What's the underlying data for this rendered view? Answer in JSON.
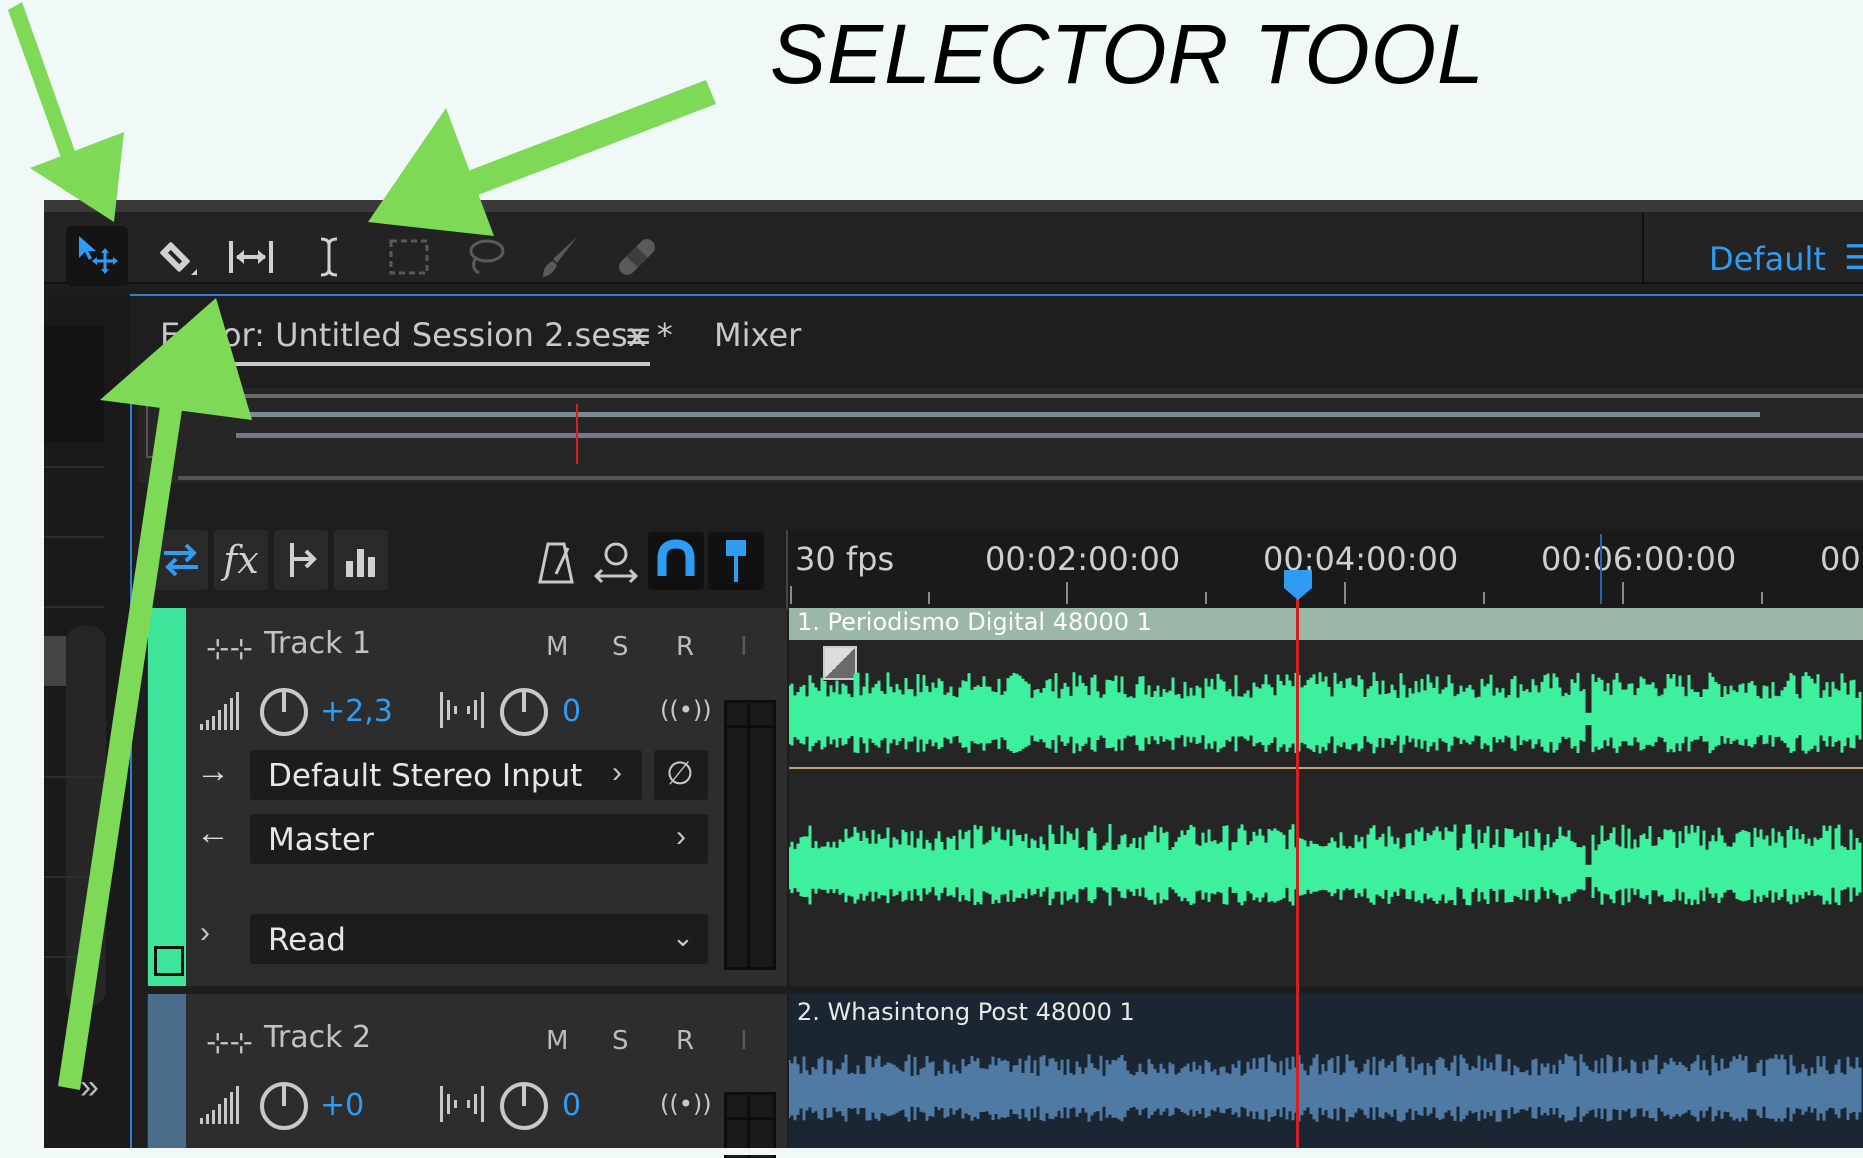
{
  "annotation": {
    "title": "SELECTOR TOOL"
  },
  "toolbar": {
    "tools": [
      {
        "name": "move-tool",
        "icon": "move-selection-icon"
      },
      {
        "name": "razor-tool",
        "icon": "razor-blade-icon"
      },
      {
        "name": "slip-tool",
        "icon": "slip-arrows-icon"
      },
      {
        "name": "time-selection-tool",
        "icon": "i-beam-icon"
      },
      {
        "name": "marquee-selection-tool",
        "icon": "marquee-icon"
      },
      {
        "name": "lasso-selection-tool",
        "icon": "lasso-icon"
      },
      {
        "name": "brush-selection-tool",
        "icon": "brush-icon"
      },
      {
        "name": "spot-healing-tool",
        "icon": "bandage-icon"
      }
    ],
    "workspace_label": "Default",
    "workspace_menu_icon": "hamburger-icon"
  },
  "tabs": {
    "editor_label": "Editor: Untitled Session 2.sesx *",
    "editor_menu_icon": "≡",
    "mixer_label": "Mixer"
  },
  "ruler": {
    "fps": "30 fps",
    "t1": "00:02:00:00",
    "t2": "00:04:00:00",
    "t3": "00:06:00:00",
    "t4": "00:"
  },
  "tracks": [
    {
      "name": "Track 1",
      "m": "M",
      "s": "S",
      "r": "R",
      "i": "I",
      "volume": "+2,3",
      "pan": "0",
      "input": "Default Stereo Input",
      "output": "Master",
      "automation": "Read",
      "color": "#3de59a"
    },
    {
      "name": "Track 2",
      "m": "M",
      "s": "S",
      "r": "R",
      "i": "I",
      "volume": "+0",
      "pan": "0",
      "color": "#4a6d8c"
    }
  ],
  "clips": [
    {
      "title": "1. Periodismo Digital  48000 1",
      "color": "#3cf09d"
    },
    {
      "title": "2. Whasintong Post 48000 1",
      "color": "#4f7aa3"
    }
  ],
  "colors": {
    "accent": "#2f9cf3",
    "annotation_arrow": "#7ed957",
    "playhead": "#d62020"
  }
}
